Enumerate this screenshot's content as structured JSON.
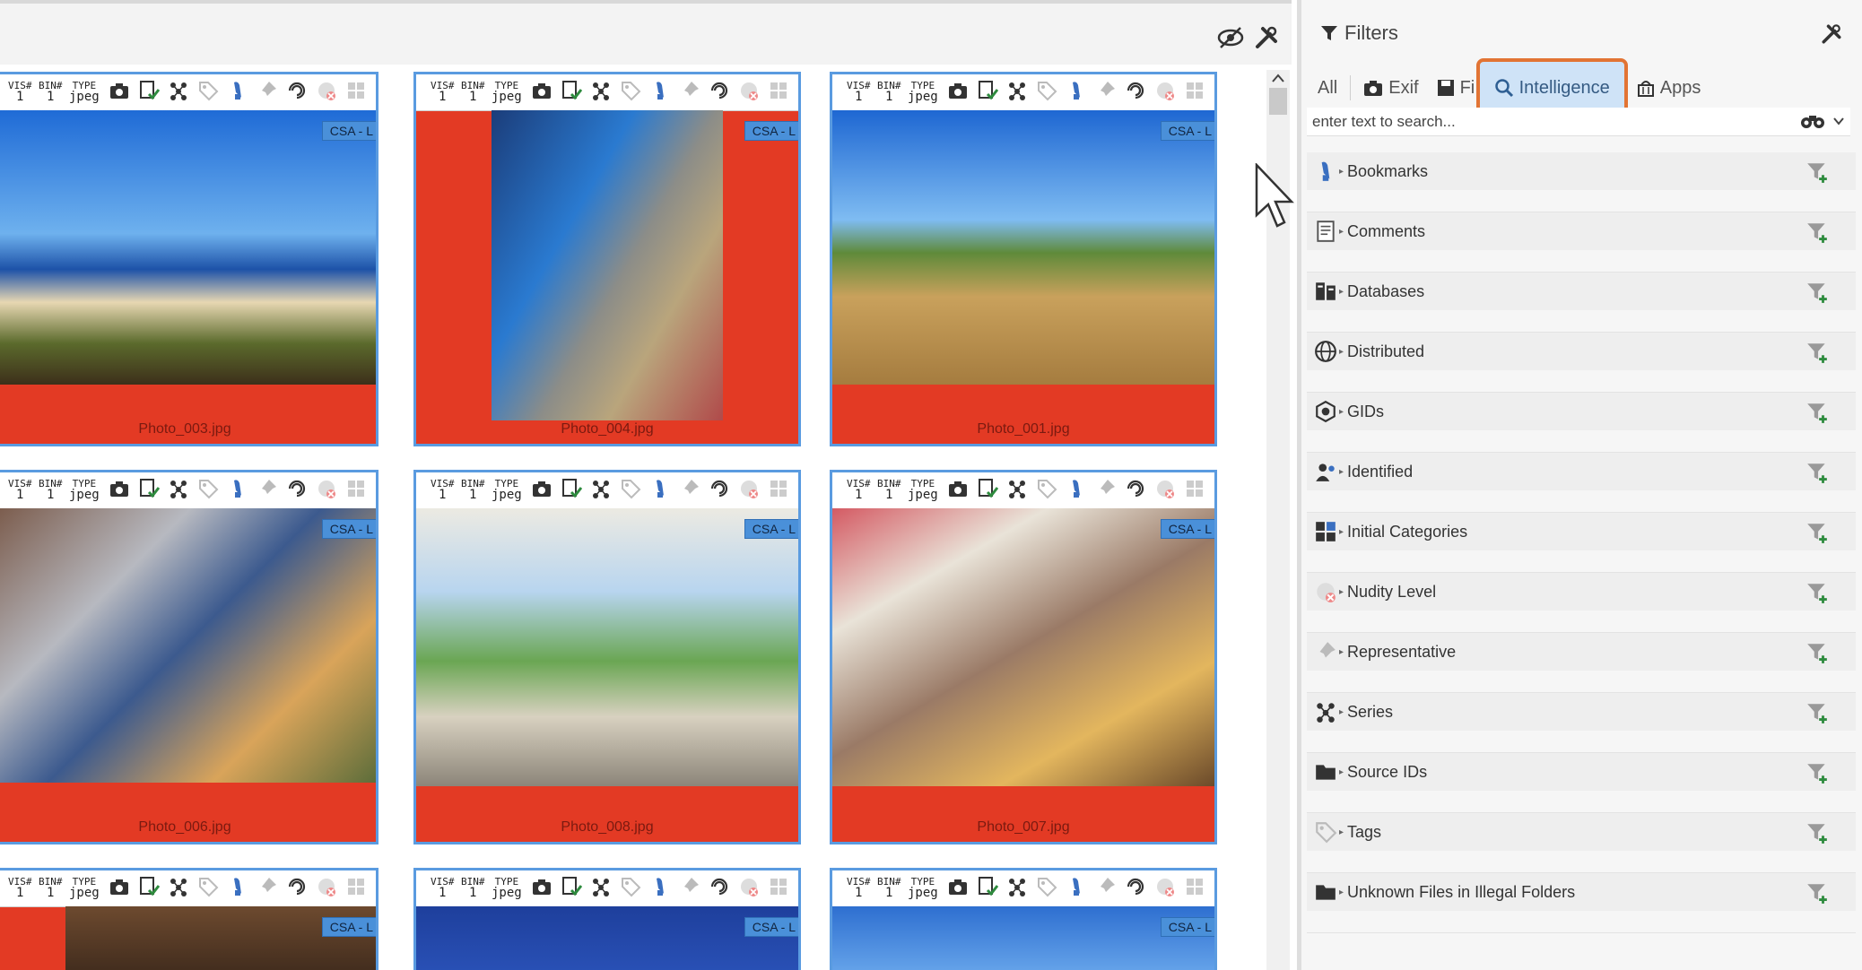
{
  "gallery": {
    "meta_labels": [
      "VIS#",
      "BIN#",
      "TYPE"
    ],
    "meta_values": [
      "1",
      "1",
      "jpeg"
    ],
    "csa_label": "CSA - L",
    "tiles": [
      {
        "name": "Photo_003.jpg"
      },
      {
        "name": "Photo_004.jpg"
      },
      {
        "name": "Photo_001.jpg"
      },
      {
        "name": "Photo_006.jpg"
      },
      {
        "name": "Photo_008.jpg"
      },
      {
        "name": "Photo_007.jpg"
      },
      {
        "name": ""
      },
      {
        "name": ""
      },
      {
        "name": ""
      }
    ],
    "tile_icons": [
      "camera-icon",
      "check-doc-icon",
      "series-icon",
      "tag-icon",
      "bookmark-icon",
      "pin-icon",
      "spiral-icon",
      "nudity-icon",
      "grid-icon"
    ]
  },
  "filters": {
    "title": "Filters",
    "tabs": {
      "all": "All",
      "exif": "Exif",
      "file": "File",
      "intelligence": "Intelligence",
      "apps": "Apps"
    },
    "search_placeholder": "enter text to search...",
    "items": [
      {
        "label": "Bookmarks",
        "icon": "bookmark-icon"
      },
      {
        "label": "Comments",
        "icon": "comment-icon"
      },
      {
        "label": "Databases",
        "icon": "database-icon"
      },
      {
        "label": "Distributed",
        "icon": "globe-icon"
      },
      {
        "label": "GIDs",
        "icon": "gid-icon"
      },
      {
        "label": "Identified",
        "icon": "person-icon"
      },
      {
        "label": "Initial Categories",
        "icon": "categories-icon"
      },
      {
        "label": "Nudity Level",
        "icon": "nudity-icon"
      },
      {
        "label": "Representative",
        "icon": "pin-icon"
      },
      {
        "label": "Series",
        "icon": "series-icon"
      },
      {
        "label": "Source IDs",
        "icon": "folder-icon"
      },
      {
        "label": "Tags",
        "icon": "tag-icon"
      },
      {
        "label": "Unknown Files in Illegal Folders",
        "icon": "folder-icon"
      }
    ]
  },
  "colors": {
    "accent_border": "#e27434",
    "tile_border": "#5a9be0",
    "tile_bg": "#e33a24",
    "csa_badge": "#4a90d9"
  }
}
